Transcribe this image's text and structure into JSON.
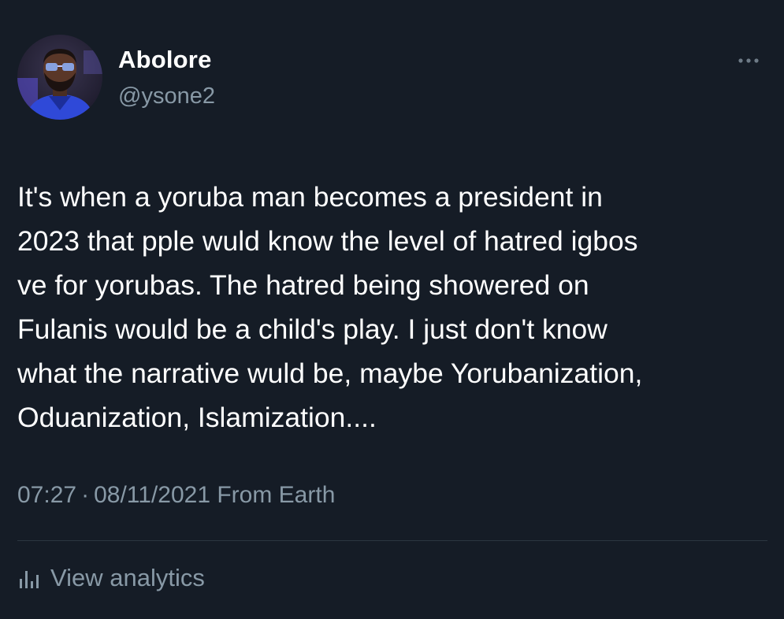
{
  "tweet": {
    "author": {
      "display_name": "Abolore",
      "handle": "@ysone2",
      "avatar_icon": "profile-photo"
    },
    "more_icon": "more-horizontal-icon",
    "text": "It's when a yoruba man becomes a president in\n2023 that pple wuld know the level of hatred igbos\nve for yorubas. The hatred being showered on\nFulanis would be a child's play. I just don't know\nwhat the narrative wuld be, maybe Yorubanization,\nOduanization, Islamization....",
    "time": "07:27",
    "separator": "·",
    "date": "08/11/2021",
    "source": "From Earth",
    "analytics": {
      "icon": "analytics-bar-icon",
      "label": "View analytics"
    }
  },
  "colors": {
    "background": "#151c26",
    "text_primary": "#ffffff",
    "text_secondary": "#8899a6",
    "divider": "#2b3640"
  }
}
